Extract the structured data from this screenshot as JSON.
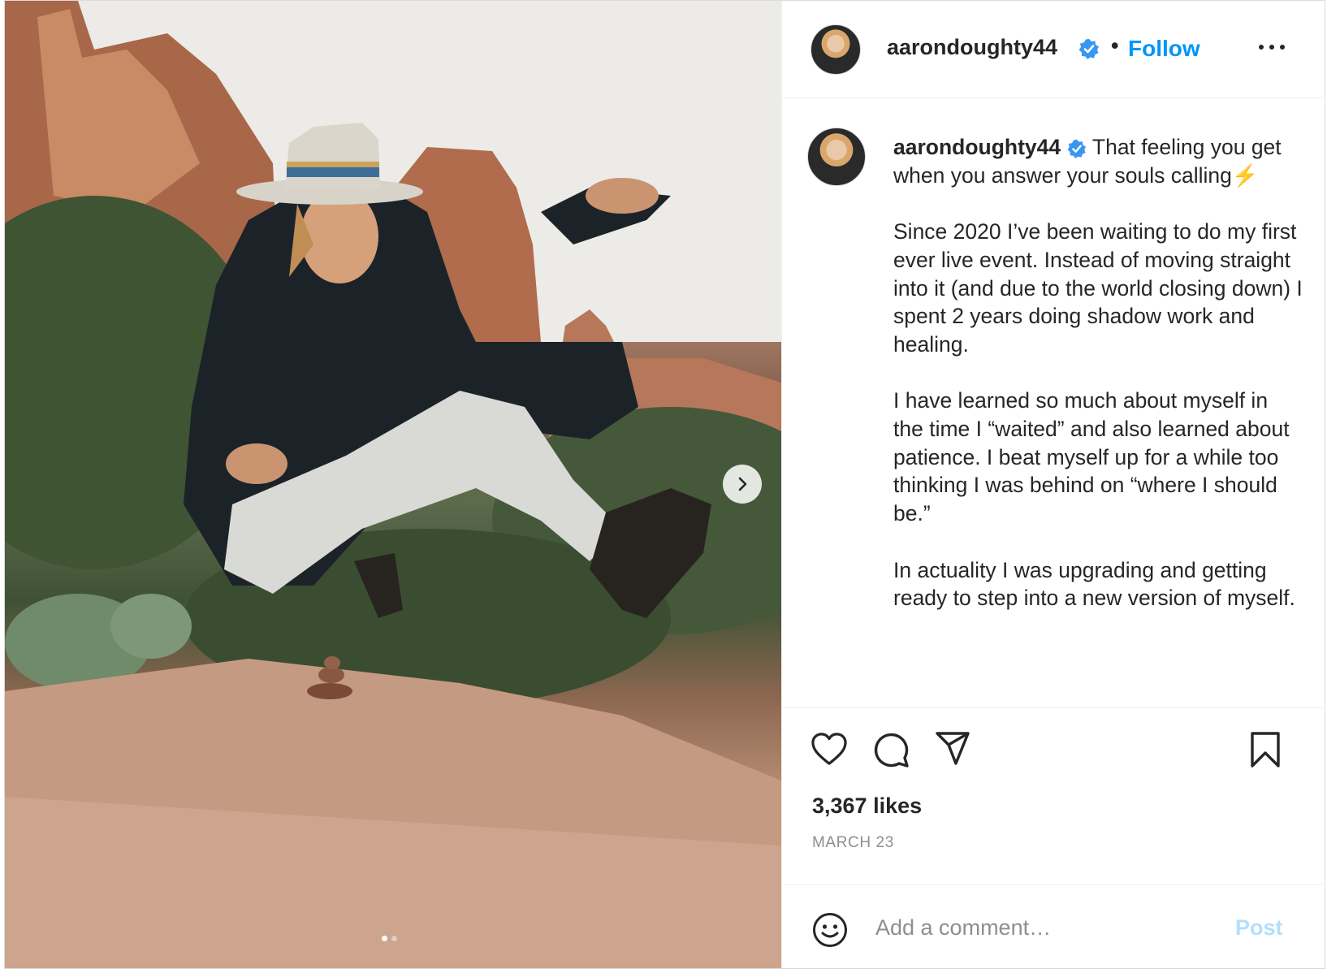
{
  "post": {
    "username": "aarondoughty44",
    "follow_label": "Follow",
    "separator": "•",
    "caption_first": "That feeling you get when you answer your souls calling⚡",
    "caption_paragraphs": [
      "Since 2020 I’ve been waiting to do my first ever live event. Instead of moving straight into it (and due to the world closing down) I spent 2 years doing shadow work and healing.",
      "I have learned so much about myself in the time I “waited” and also learned about patience. I beat myself up for a while too thinking I was behind on “where I should be.”",
      "In actuality I was upgrading and getting ready to step into a new version of myself."
    ],
    "likes": "3,367 likes",
    "date": "MARCH 23",
    "comment_placeholder": "Add a comment…",
    "post_label": "Post"
  },
  "carousel": {
    "slide_count": 2,
    "active_index": 0
  },
  "icons": {
    "verified": "verified-badge-icon",
    "more": "more-options-icon",
    "like": "heart-icon",
    "comment": "comment-bubble-icon",
    "share": "paper-plane-icon",
    "save": "bookmark-icon",
    "emoji": "emoji-icon",
    "next": "chevron-right-icon"
  },
  "colors": {
    "accent": "#0095f6",
    "verified": "#3897f0",
    "post_disabled": "#b2dffc",
    "muted": "#8e8e8e",
    "text": "#262626"
  }
}
